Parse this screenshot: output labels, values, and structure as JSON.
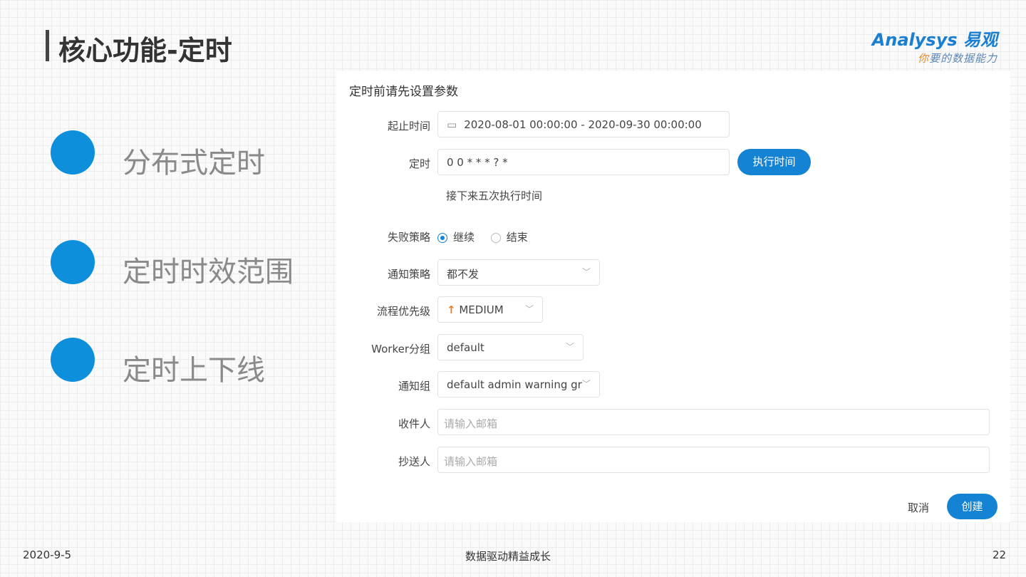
{
  "slide": {
    "title": "核心功能-定时",
    "date": "2020-9-5",
    "footer": "数据驱动精益成长",
    "page": "22"
  },
  "logo": {
    "brand": "Analysys 易观",
    "tagline_accent": "你",
    "tagline": "要的数据能力"
  },
  "bullets": [
    "分布式定时",
    "定时时效范围",
    "定时上下线"
  ],
  "colors": {
    "accent": "#0d8fdc",
    "button": "#1483d4",
    "priority": "#f07c21"
  },
  "form": {
    "heading": "定时前请先设置参数",
    "time_range": {
      "label": "起止时间",
      "value": "2020-08-01 00:00:00 - 2020-09-30 00:00:00",
      "icon": "calendar-icon"
    },
    "cron": {
      "label": "定时",
      "value": "0 0 * * * ? *",
      "button": "执行时间"
    },
    "next_runs_label": "接下来五次执行时间",
    "failure": {
      "label": "失败策略",
      "options": [
        "继续",
        "结束"
      ],
      "selected": "继续"
    },
    "notify": {
      "label": "通知策略",
      "value": "都不发"
    },
    "priority": {
      "label": "流程优先级",
      "value": "MEDIUM"
    },
    "worker": {
      "label": "Worker分组",
      "value": "default"
    },
    "notify_group": {
      "label": "通知组",
      "value": "default admin warning gr"
    },
    "receiver": {
      "label": "收件人",
      "placeholder": "请输入邮箱"
    },
    "cc": {
      "label": "抄送人",
      "placeholder": "请输入邮箱"
    },
    "cancel": "取消",
    "create": "创建"
  }
}
